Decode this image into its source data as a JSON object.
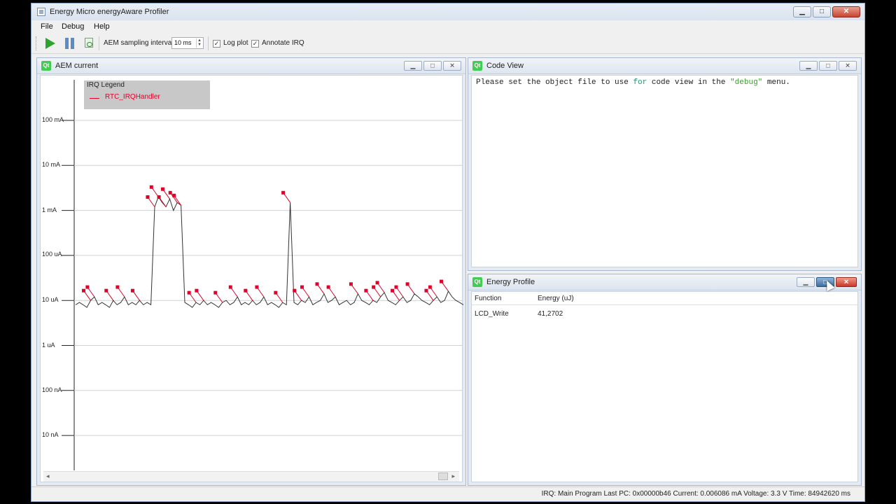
{
  "window": {
    "title": "Energy Micro energyAware Profiler",
    "buttons": {
      "minimize": "▁",
      "maximize": "□",
      "close": "✕"
    }
  },
  "menu": [
    "File",
    "Debug",
    "Help"
  ],
  "toolbar": {
    "sampling_label": "AEM sampling interval",
    "sampling_value": "10 ms",
    "log_plot_label": "Log plot",
    "log_plot_checked": true,
    "annotate_irq_label": "Annotate IRQ",
    "annotate_irq_checked": true,
    "icons": [
      "play-icon",
      "pause-icon",
      "reset-icon"
    ]
  },
  "aem_panel": {
    "title": "AEM current",
    "qt_badge": "Qt",
    "legend": {
      "title": "IRQ Legend",
      "entry": "RTC_IRQHandler",
      "entry_color": "#e0002a"
    }
  },
  "chart_data": {
    "type": "line",
    "title": "",
    "yscale": "log",
    "ylim": [
      "10 nA",
      "100 mA"
    ],
    "y_tick_labels": [
      "100 mA",
      "10 mA",
      "1 mA",
      "100 uA",
      "10 uA",
      "1 uA",
      "100 nA",
      "10 nA"
    ],
    "series": [
      {
        "values_uA": [
          8,
          9,
          8,
          7,
          10,
          12,
          8,
          9,
          8,
          7,
          10,
          8,
          9,
          12,
          8,
          9,
          8,
          10,
          8,
          9,
          8,
          1200,
          2000,
          1500,
          1200,
          1800,
          1000,
          1500,
          1300,
          9,
          8,
          7,
          9,
          8,
          10,
          8,
          9,
          8,
          7,
          9,
          10,
          8,
          9,
          12,
          8,
          9,
          8,
          10,
          8,
          9,
          12,
          8,
          9,
          8,
          7,
          9,
          8,
          1500,
          9,
          8,
          10,
          9,
          12,
          8,
          9,
          10,
          14,
          9,
          10,
          12,
          8,
          9,
          10,
          8,
          9,
          14,
          10,
          9,
          8,
          10,
          9,
          12,
          15,
          10,
          9,
          8,
          10,
          12,
          9,
          10,
          14,
          12,
          10,
          9,
          8,
          10,
          12,
          9,
          10,
          16,
          12,
          10,
          9,
          8
        ]
      }
    ],
    "annotations": {
      "name": "RTC_IRQHandler",
      "color": "#e0002a"
    },
    "grid": true
  },
  "code_panel": {
    "title": "Code View",
    "qt_badge": "Qt",
    "text_pre": "Please set the object file to use ",
    "text_kw": "for",
    "text_mid": " code view in the ",
    "text_str": "\"debug\"",
    "text_post": " menu."
  },
  "energy_panel": {
    "title": "Energy Profile",
    "qt_badge": "Qt",
    "columns": [
      "Function",
      "Energy (uJ)"
    ],
    "rows": [
      {
        "function": "LCD_Write",
        "energy": "41,2702"
      }
    ]
  },
  "status": {
    "text": "IRQ: Main Program  Last PC: 0x00000b46  Current: 0.006086 mA  Voltage: 3.3 V  Time: 84942620 ms"
  }
}
